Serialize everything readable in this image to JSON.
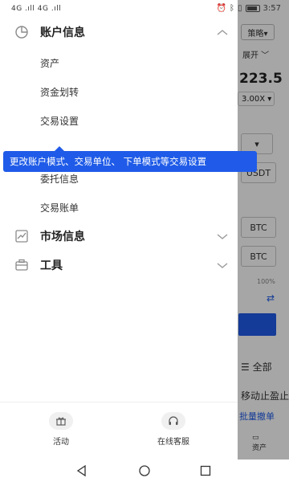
{
  "status_bar": {
    "left_text": "4G .ıll 4G .ıll",
    "time": "3:57"
  },
  "background": {
    "strategy_label": "策略▾",
    "expand_label": "展开 ﹀",
    "price": "223.5",
    "leverage": "3.00X ▾",
    "unit_usdt": "USDT",
    "btc_1": "BTC",
    "btc_2": "BTC",
    "percent": "100%",
    "all_label": "☰ 全部",
    "trailing_stop": "移动止盈止",
    "batch_cancel": "批量撤单",
    "assets_tab": "资产"
  },
  "drawer": {
    "account_info": {
      "label": "账户信息",
      "items": [
        "资产",
        "资金划转",
        "交易设置",
        "委托信息",
        "交易账单"
      ]
    },
    "tooltip": "更改账户模式、交易单位、 下单模式等交易设置",
    "market_info": {
      "label": "市场信息"
    },
    "tools": {
      "label": "工具"
    },
    "bottom": {
      "activity": "活动",
      "support": "在线客服"
    }
  },
  "colors": {
    "accent": "#1f5be8",
    "dim_overlay": "rgba(0,0,0,0.35)"
  }
}
